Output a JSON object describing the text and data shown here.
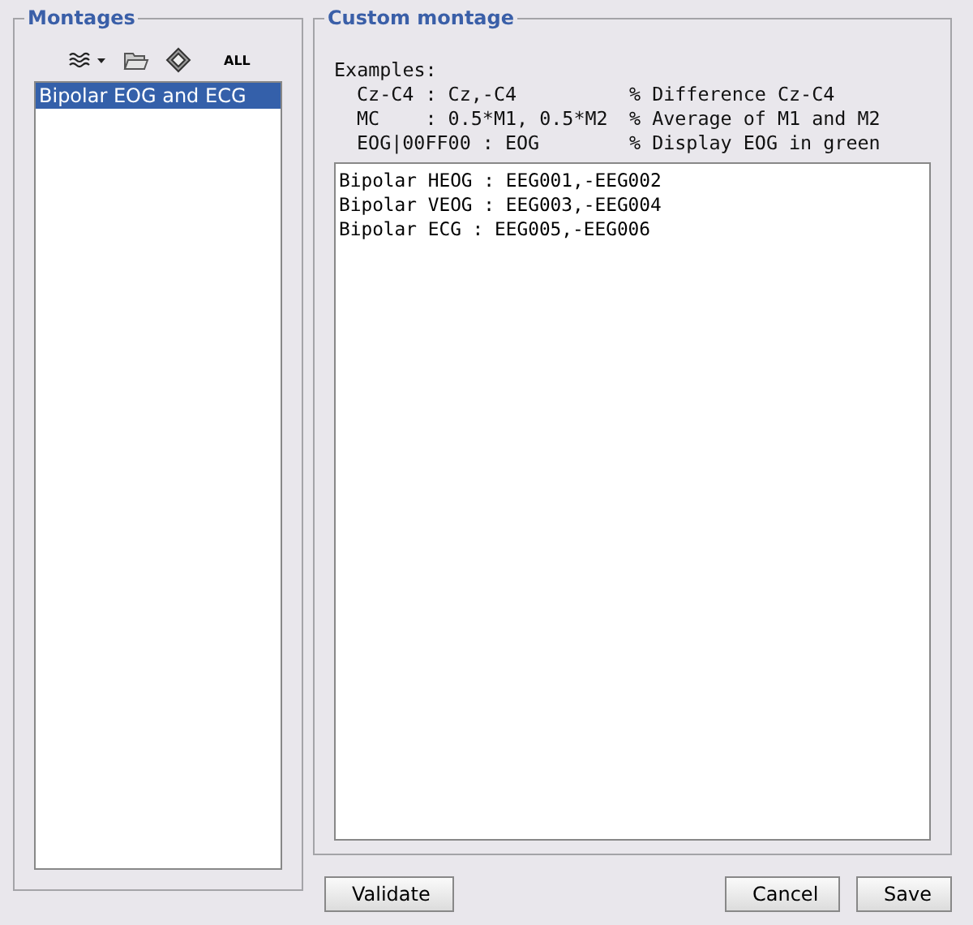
{
  "montages_panel": {
    "title": "Montages",
    "toolbar": [
      {
        "kind": "wave-menu"
      },
      {
        "kind": "folder"
      },
      {
        "kind": "disk"
      },
      {
        "kind": "text",
        "label": "ALL"
      }
    ],
    "items": [
      {
        "label": "Bipolar EOG and ECG",
        "selected": true
      }
    ]
  },
  "custom_panel": {
    "title": "Custom montage",
    "examples_title": "Examples:",
    "examples": [
      {
        "expr": "Cz-C4 : Cz,-C4",
        "comment": "% Difference Cz-C4"
      },
      {
        "expr": "MC    : 0.5*M1, 0.5*M2",
        "comment": "% Average of M1 and M2"
      },
      {
        "expr": "EOG|00FF00 : EOG",
        "comment": "% Display EOG in green"
      }
    ],
    "editor_lines": [
      "Bipolar HEOG : EEG001,-EEG002",
      "Bipolar VEOG : EEG003,-EEG004",
      "Bipolar ECG : EEG005,-EEG006"
    ]
  },
  "buttons": {
    "left": [
      "Validate"
    ],
    "right": [
      "Cancel",
      "Save"
    ]
  }
}
